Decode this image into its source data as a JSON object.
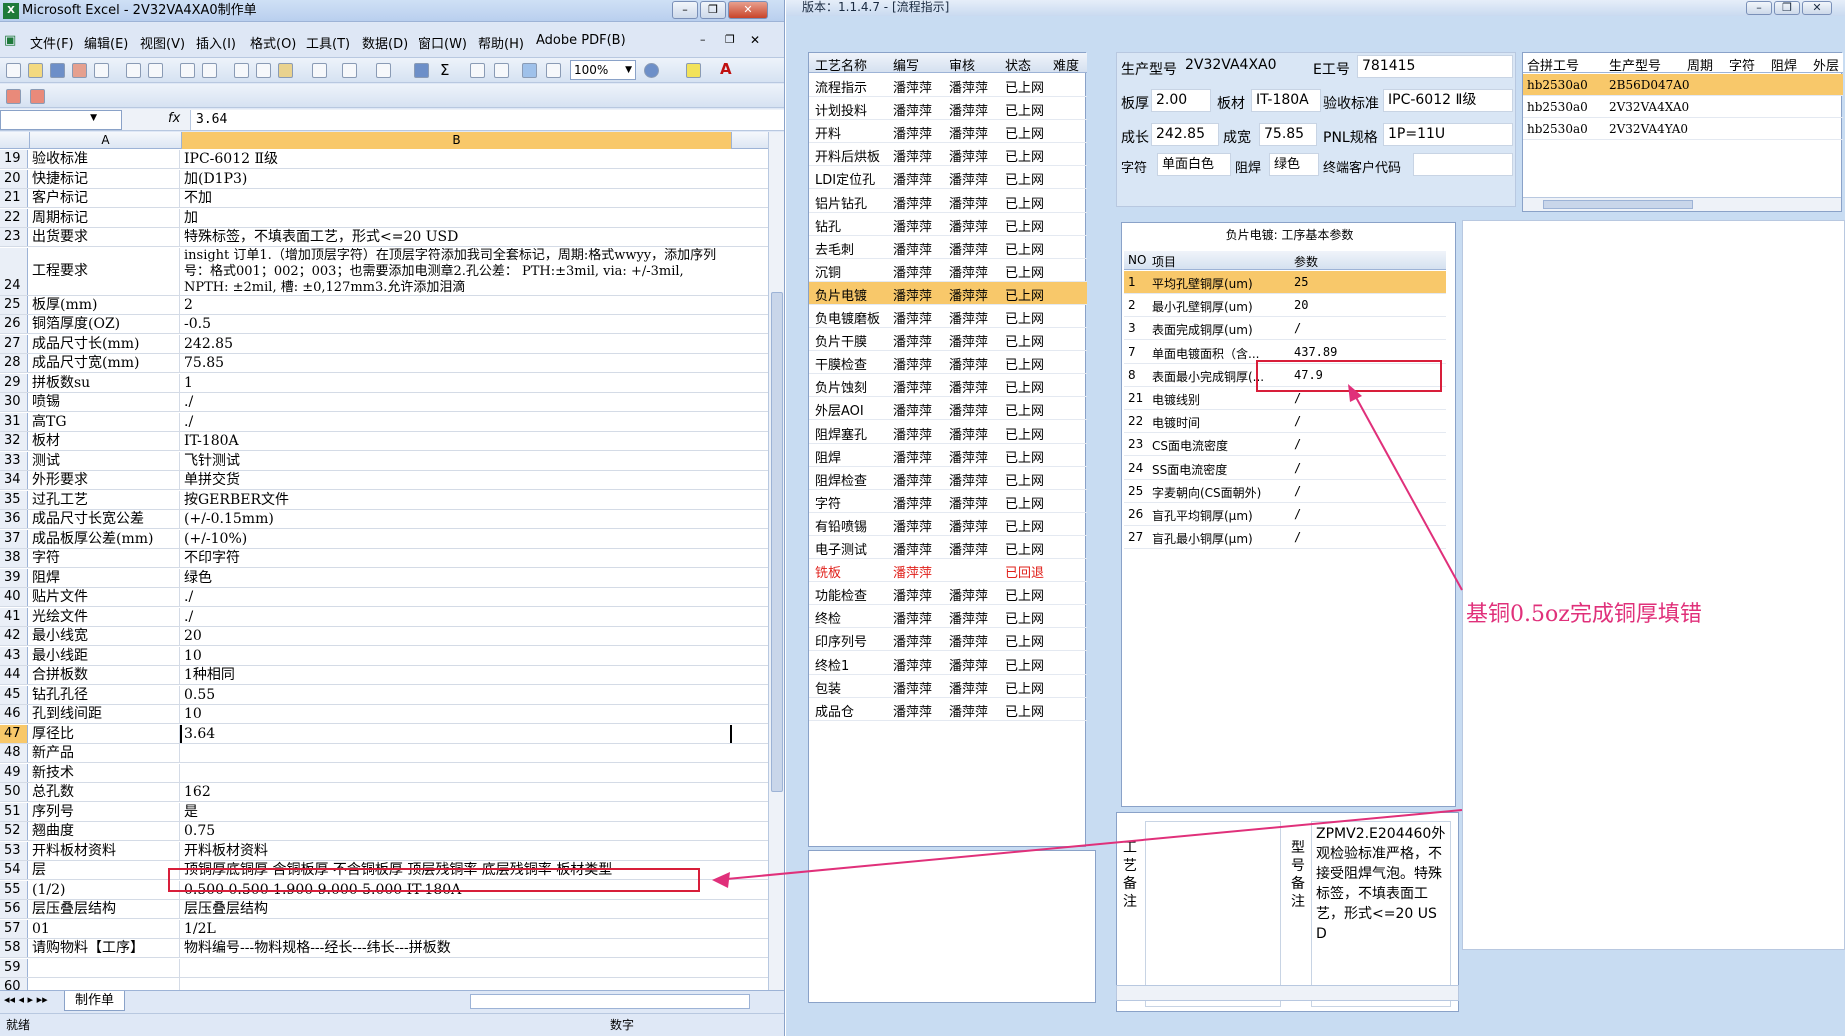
{
  "excel": {
    "title": "Microsoft Excel - 2V32VA4XA0制作单",
    "menu": [
      "文件(F)",
      "编辑(E)",
      "视图(V)",
      "插入(I)",
      "格式(O)",
      "工具(T)",
      "数据(D)",
      "窗口(W)",
      "帮助(H)",
      "Adobe PDF(B)"
    ],
    "zoom": "100%",
    "namebox": "",
    "fx": "fx",
    "formula_value": "3.64",
    "col_a": "A",
    "col_b": "B",
    "rows": [
      {
        "n": "19",
        "a": "验收标准",
        "b": "IPC-6012 Ⅱ级"
      },
      {
        "n": "20",
        "a": "快捷标记",
        "b": "加(D1P3)"
      },
      {
        "n": "21",
        "a": "客户标记",
        "b": "不加"
      },
      {
        "n": "22",
        "a": "周期标记",
        "b": "加"
      },
      {
        "n": "23",
        "a": "出货要求",
        "b": "特殊标签，不填表面工艺，形式<=20 USD"
      },
      {
        "n": "24",
        "a": "工程要求",
        "b": "insight 订单1.（增加顶层字符）在顶层字符添加我司全套标记，周期:格式wwyy，添加序列号：格式001；002；003；也需要添加电测章2.孔公差： PTH:±3mil,  via: +/-3mil,  NPTH: ±2mil,  槽: ±0,127mm3.允许添加泪滴"
      },
      {
        "n": "25",
        "a": "板厚(mm)",
        "b": "2"
      },
      {
        "n": "26",
        "a": "铜箔厚度(OZ)",
        "b": "-0.5"
      },
      {
        "n": "27",
        "a": "成品尺寸长(mm)",
        "b": "242.85"
      },
      {
        "n": "28",
        "a": "成品尺寸宽(mm)",
        "b": "75.85"
      },
      {
        "n": "29",
        "a": "拼板数su",
        "b": "1"
      },
      {
        "n": "30",
        "a": "喷锡",
        "b": "./"
      },
      {
        "n": "31",
        "a": "高TG",
        "b": "./"
      },
      {
        "n": "32",
        "a": "板材",
        "b": "IT-180A"
      },
      {
        "n": "33",
        "a": "测试",
        "b": "飞针测试"
      },
      {
        "n": "34",
        "a": "外形要求",
        "b": "单拼交货"
      },
      {
        "n": "35",
        "a": "过孔工艺",
        "b": "按GERBER文件"
      },
      {
        "n": "36",
        "a": "成品尺寸长宽公差",
        "b": "(+/-0.15mm)"
      },
      {
        "n": "37",
        "a": "成品板厚公差(mm)",
        "b": "(+/-10%)"
      },
      {
        "n": "38",
        "a": "字符",
        "b": "不印字符"
      },
      {
        "n": "39",
        "a": "阻焊",
        "b": "绿色"
      },
      {
        "n": "40",
        "a": "贴片文件",
        "b": "./"
      },
      {
        "n": "41",
        "a": "光绘文件",
        "b": "./"
      },
      {
        "n": "42",
        "a": "最小线宽",
        "b": "20"
      },
      {
        "n": "43",
        "a": "最小线距",
        "b": "10"
      },
      {
        "n": "44",
        "a": "合拼板数",
        "b": "1种相同"
      },
      {
        "n": "45",
        "a": "钻孔孔径",
        "b": "0.55"
      },
      {
        "n": "46",
        "a": "孔到线间距",
        "b": "10"
      },
      {
        "n": "47",
        "a": "厚径比",
        "b": "3.64"
      },
      {
        "n": "48",
        "a": "新产品",
        "b": ""
      },
      {
        "n": "49",
        "a": "新技术",
        "b": ""
      },
      {
        "n": "50",
        "a": "总孔数",
        "b": "162"
      },
      {
        "n": "51",
        "a": "序列号",
        "b": "是"
      },
      {
        "n": "52",
        "a": "翘曲度",
        "b": "0.75"
      },
      {
        "n": "53",
        "a": "开料板材资料",
        "b": "开料板材资料"
      },
      {
        "n": "54",
        "a": "层",
        "b": "顶铜厚底铜厚  含铜板厚  不含铜板厚  顶层残铜率  底层残铜率  板材类型"
      },
      {
        "n": "55",
        "a": "(1/2)",
        "b": "0.500  0.500   1.900              9.000      5.000      IT-180A"
      },
      {
        "n": "56",
        "a": "层压叠层结构",
        "b": "层压叠层结构"
      },
      {
        "n": "57",
        "a": "01",
        "b": "1/2L"
      },
      {
        "n": "58",
        "a": "请购物料【工序】",
        "b": "物料编号---物料规格---经长---纬长---拼板数"
      },
      {
        "n": "59",
        "a": "",
        "b": ""
      },
      {
        "n": "60",
        "a": "",
        "b": ""
      }
    ],
    "selected_row": "47",
    "sheet_tab": "制作单",
    "status_left": "就绪",
    "status_mid": "数字"
  },
  "app": {
    "title": "版本：1.1.4.7 - [流程指示]",
    "proc_headers": [
      "工艺名称",
      "编写",
      "审核",
      "状态",
      "难度"
    ],
    "processes": [
      {
        "name": "流程指示",
        "w": "潘萍萍",
        "r": "潘萍萍",
        "s": "已上网"
      },
      {
        "name": "计划投料",
        "w": "潘萍萍",
        "r": "潘萍萍",
        "s": "已上网"
      },
      {
        "name": "开料",
        "w": "潘萍萍",
        "r": "潘萍萍",
        "s": "已上网"
      },
      {
        "name": "开料后烘板",
        "w": "潘萍萍",
        "r": "潘萍萍",
        "s": "已上网"
      },
      {
        "name": "LDI定位孔",
        "w": "潘萍萍",
        "r": "潘萍萍",
        "s": "已上网"
      },
      {
        "name": "铝片钻孔",
        "w": "潘萍萍",
        "r": "潘萍萍",
        "s": "已上网"
      },
      {
        "name": "钻孔",
        "w": "潘萍萍",
        "r": "潘萍萍",
        "s": "已上网"
      },
      {
        "name": "去毛刺",
        "w": "潘萍萍",
        "r": "潘萍萍",
        "s": "已上网"
      },
      {
        "name": "沉铜",
        "w": "潘萍萍",
        "r": "潘萍萍",
        "s": "已上网"
      },
      {
        "name": "负片电镀",
        "w": "潘萍萍",
        "r": "潘萍萍",
        "s": "已上网"
      },
      {
        "name": "负电镀磨板",
        "w": "潘萍萍",
        "r": "潘萍萍",
        "s": "已上网"
      },
      {
        "name": "负片干膜",
        "w": "潘萍萍",
        "r": "潘萍萍",
        "s": "已上网"
      },
      {
        "name": "干膜检查",
        "w": "潘萍萍",
        "r": "潘萍萍",
        "s": "已上网"
      },
      {
        "name": "负片蚀刻",
        "w": "潘萍萍",
        "r": "潘萍萍",
        "s": "已上网"
      },
      {
        "name": "外层AOI",
        "w": "潘萍萍",
        "r": "潘萍萍",
        "s": "已上网"
      },
      {
        "name": "阻焊塞孔",
        "w": "潘萍萍",
        "r": "潘萍萍",
        "s": "已上网"
      },
      {
        "name": "阻焊",
        "w": "潘萍萍",
        "r": "潘萍萍",
        "s": "已上网"
      },
      {
        "name": "阻焊检查",
        "w": "潘萍萍",
        "r": "潘萍萍",
        "s": "已上网"
      },
      {
        "name": "字符",
        "w": "潘萍萍",
        "r": "潘萍萍",
        "s": "已上网"
      },
      {
        "name": "有铅喷锡",
        "w": "潘萍萍",
        "r": "潘萍萍",
        "s": "已上网"
      },
      {
        "name": "电子测试",
        "w": "潘萍萍",
        "r": "潘萍萍",
        "s": "已上网"
      },
      {
        "name": "铣板",
        "w": "潘萍萍",
        "r": "",
        "s": "已回退"
      },
      {
        "name": "功能检查",
        "w": "潘萍萍",
        "r": "潘萍萍",
        "s": "已上网"
      },
      {
        "name": "终检",
        "w": "潘萍萍",
        "r": "潘萍萍",
        "s": "已上网"
      },
      {
        "name": "印序列号",
        "w": "潘萍萍",
        "r": "潘萍萍",
        "s": "已上网"
      },
      {
        "name": "终检1",
        "w": "潘萍萍",
        "r": "潘萍萍",
        "s": "已上网"
      },
      {
        "name": "包装",
        "w": "潘萍萍",
        "r": "潘萍萍",
        "s": "已上网"
      },
      {
        "name": "成品仓",
        "w": "潘萍萍",
        "r": "潘萍萍",
        "s": "已上网"
      }
    ],
    "selected_process_index": 9,
    "rollback_index": 21,
    "info": {
      "model_label": "生产型号",
      "model": "2V32VA4XA0",
      "eno_label": "E工号",
      "eno": "781415",
      "thick_label": "板厚",
      "thick": "2.00",
      "mat_label": "板材",
      "mat": "IT-180A",
      "std_label": "验收标准",
      "std": "IPC-6012 Ⅱ级",
      "len_label": "成长",
      "len": "242.85",
      "wid_label": "成宽",
      "wid": "75.85",
      "pnl_label": "PNL规格",
      "pnl": "1P=11U",
      "char_label": "字符",
      "char": "单面白色",
      "mask_label": "阻焊",
      "mask": "绿色",
      "cust_label": "终端客户代码",
      "cust": ""
    },
    "combo_headers": [
      "合拼工号",
      "生产型号",
      "周期",
      "字符",
      "阻焊",
      "外层"
    ],
    "combo_rows": [
      {
        "a": "hb2530a0",
        "b": "2B56D047A0"
      },
      {
        "a": "hb2530a0",
        "b": "2V32VA4XA0"
      },
      {
        "a": "hb2530a0",
        "b": "2V32VA4YA0"
      }
    ],
    "params_caption": "负片电镀: 工序基本参数",
    "params_headers": [
      "NO",
      "项目",
      "参数"
    ],
    "params": [
      {
        "no": "1",
        "item": "平均孔壁铜厚(um)",
        "val": "25"
      },
      {
        "no": "2",
        "item": "最小孔壁铜厚(um)",
        "val": "20"
      },
      {
        "no": "3",
        "item": "表面完成铜厚(um)",
        "val": "/"
      },
      {
        "no": "7",
        "item": "单面电镀面积（含...",
        "val": "437.89"
      },
      {
        "no": "8",
        "item": "表面最小完成铜厚(...",
        "val": "47.9"
      },
      {
        "no": "21",
        "item": "电镀线别",
        "val": "/"
      },
      {
        "no": "22",
        "item": "电镀时间",
        "val": "/"
      },
      {
        "no": "23",
        "item": "CS面电流密度",
        "val": "/"
      },
      {
        "no": "24",
        "item": "SS面电流密度",
        "val": "/"
      },
      {
        "no": "25",
        "item": "字麦朝向(CS面朝外)",
        "val": "/"
      },
      {
        "no": "26",
        "item": "盲孔平均铜厚(μm)",
        "val": "/"
      },
      {
        "no": "27",
        "item": "盲孔最小铜厚(μm)",
        "val": "/"
      }
    ],
    "memo_process_label": "工艺备注",
    "memo_model_label": "型号备注",
    "memo_text": "ZPMV2.E204460外观检验标准严格，不接受阻焊气泡。特殊标签，不填表面工艺，形式<=20 USD",
    "annotation": "基铜0.5oz完成铜厚填错",
    "colors": {
      "highlight": "#f8c86a",
      "annotation": "#e0307a",
      "rollback": "#e0201a"
    }
  }
}
